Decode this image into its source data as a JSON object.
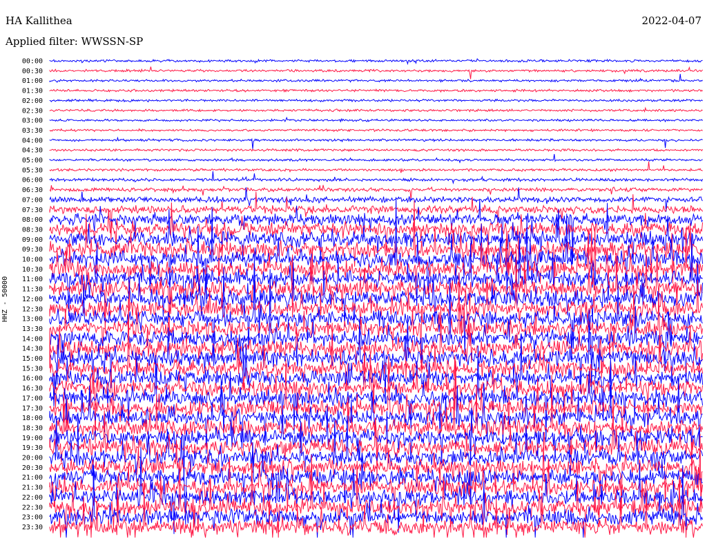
{
  "header": {
    "station": "HA Kallithea",
    "date": "2022-04-07",
    "filter": "Applied filter: WWSSN-SP"
  },
  "chart_data": {
    "type": "line",
    "title": "HA Kallithea",
    "ylabel": "HHZ - 50000",
    "xlabel": "",
    "colors": [
      "#0000ff",
      "#ff1744"
    ],
    "row_labels": [
      "00:00",
      "00:30",
      "01:00",
      "01:30",
      "02:00",
      "02:30",
      "03:00",
      "03:30",
      "04:00",
      "04:30",
      "05:00",
      "05:30",
      "06:00",
      "06:30",
      "07:00",
      "07:30",
      "08:00",
      "08:30",
      "09:00",
      "09:30",
      "10:00",
      "10:30",
      "11:00",
      "11:30",
      "12:00",
      "12:30",
      "13:00",
      "13:30",
      "14:00",
      "14:30",
      "15:00",
      "15:30",
      "16:00",
      "16:30",
      "17:00",
      "17:30",
      "18:00",
      "18:30",
      "19:00",
      "19:30",
      "20:00",
      "20:30",
      "21:00",
      "21:30",
      "22:00",
      "22:30",
      "23:00",
      "23:30"
    ],
    "amplitude_level": [
      0.3,
      0.35,
      0.3,
      0.4,
      0.15,
      0.1,
      0.12,
      0.1,
      0.25,
      0.12,
      0.3,
      0.5,
      0.6,
      0.7,
      1.2,
      1.5,
      2.2,
      2.6,
      2.8,
      3.0,
      3.0,
      3.0,
      3.0,
      3.0,
      3.0,
      3.0,
      3.0,
      3.0,
      3.0,
      3.0,
      3.0,
      3.0,
      3.0,
      3.0,
      3.0,
      3.0,
      3.0,
      3.0,
      3.0,
      3.0,
      3.0,
      3.0,
      3.0,
      3.0,
      3.0,
      3.0,
      3.0,
      3.0
    ]
  }
}
